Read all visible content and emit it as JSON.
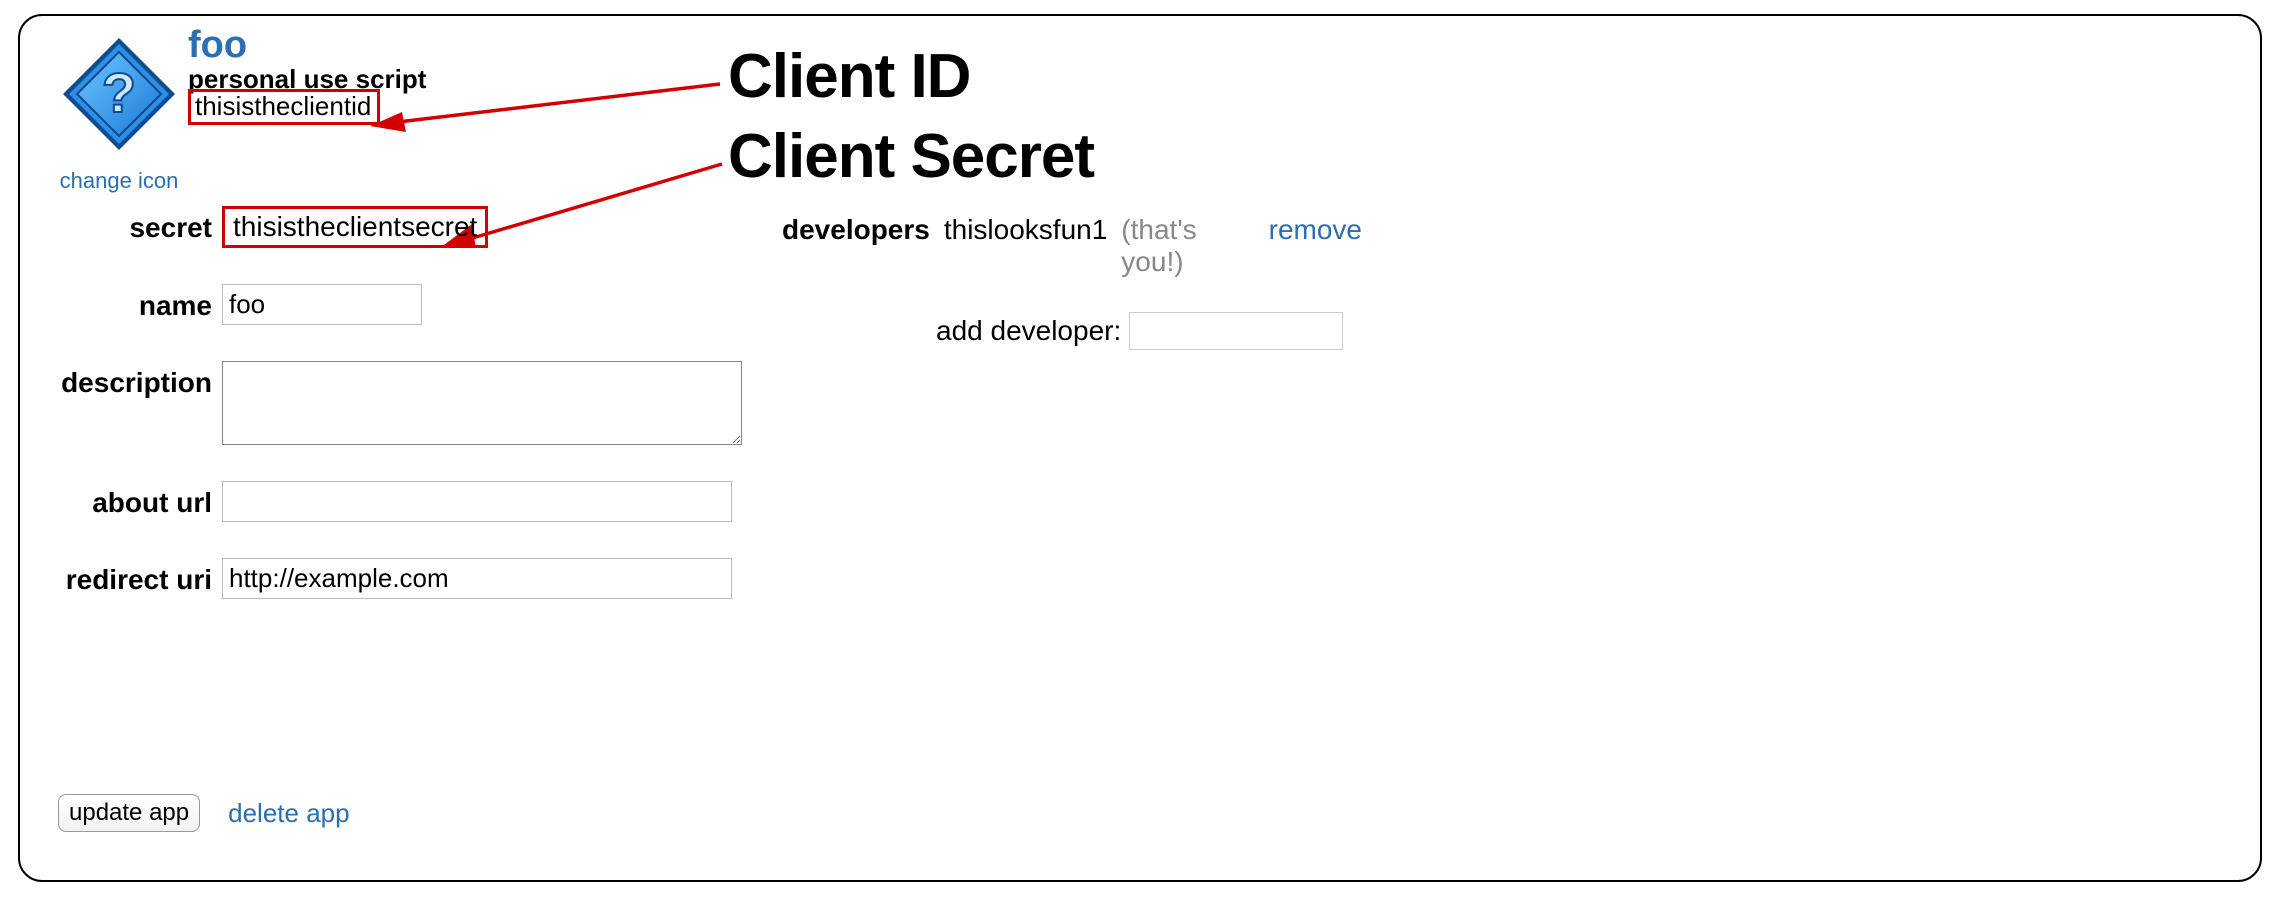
{
  "header": {
    "app_title": "foo",
    "app_type": "personal use script",
    "client_id": "thisistheclientid",
    "change_icon_label": "change icon"
  },
  "annotations": {
    "client_id_label": "Client ID",
    "client_secret_label": "Client Secret"
  },
  "form": {
    "secret_label": "secret",
    "secret_value": "thisistheclientsecret",
    "name_label": "name",
    "name_value": "foo",
    "description_label": "description",
    "description_value": "",
    "about_label": "about url",
    "about_value": "",
    "redirect_label": "redirect uri",
    "redirect_value": "http://example.com"
  },
  "actions": {
    "update_label": "update app",
    "delete_label": "delete app"
  },
  "developers": {
    "heading": "developers",
    "user": "thislooksfun1",
    "thats_you": "(that's you!)",
    "remove_label": "remove",
    "add_label": "add developer:",
    "add_value": ""
  }
}
